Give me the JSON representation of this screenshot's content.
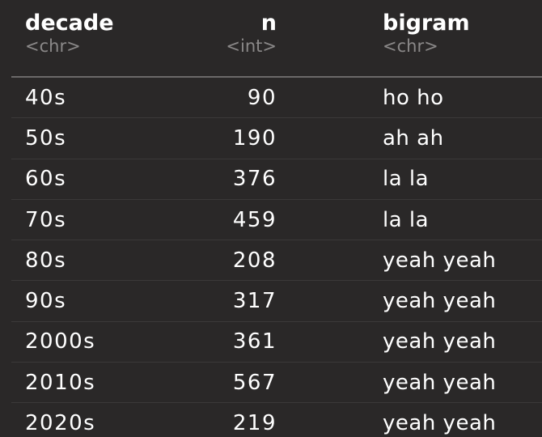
{
  "table": {
    "columns": [
      {
        "name": "decade",
        "type": "<chr>"
      },
      {
        "name": "n",
        "type": "<int>"
      },
      {
        "name": "bigram",
        "type": "<chr>"
      }
    ],
    "rows": [
      {
        "decade": "40s",
        "n": "90",
        "bigram": "ho ho"
      },
      {
        "decade": "50s",
        "n": "190",
        "bigram": "ah ah"
      },
      {
        "decade": "60s",
        "n": "376",
        "bigram": "la la"
      },
      {
        "decade": "70s",
        "n": "459",
        "bigram": "la la"
      },
      {
        "decade": "80s",
        "n": "208",
        "bigram": "yeah yeah"
      },
      {
        "decade": "90s",
        "n": "317",
        "bigram": "yeah yeah"
      },
      {
        "decade": "2000s",
        "n": "361",
        "bigram": "yeah yeah"
      },
      {
        "decade": "2010s",
        "n": "567",
        "bigram": "yeah yeah"
      },
      {
        "decade": "2020s",
        "n": "219",
        "bigram": "yeah yeah"
      }
    ]
  },
  "colors": {
    "background": "#2a2828",
    "text": "#ffffff",
    "type_text": "#8a8888",
    "rule": "#6b6969"
  }
}
